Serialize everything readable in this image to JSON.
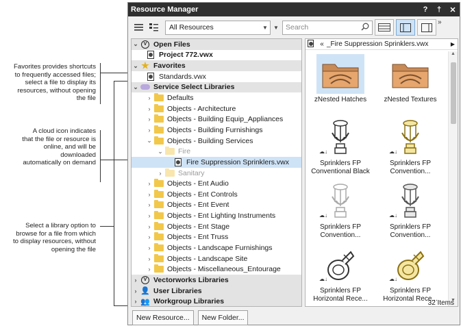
{
  "annotations": {
    "favorites": "Favorites provides shortcuts to frequently accessed files; select a file to display its resources, without opening the file",
    "cloud": "A cloud icon indicates that the file or resource is online, and will be downloaded automatically on demand",
    "libraries": "Select a library option to browse for a file from which to display resources, without opening the file"
  },
  "window": {
    "title": "Resource Manager",
    "help": "?",
    "pin": "†",
    "close": "✕"
  },
  "toolbar": {
    "filter_value": "All Resources",
    "search_placeholder": "Search",
    "more": "»"
  },
  "tree": {
    "open_files": "Open Files",
    "project": "Project 772.vwx",
    "favorites": "Favorites",
    "standards": "Standards.vwx",
    "service_select": "Service Select Libraries",
    "folders_a": [
      "Defaults",
      "Objects - Architecture",
      "Objects - Building Equip_Appliances",
      "Objects - Building Furnishings",
      "Objects - Building Services"
    ],
    "fire": "Fire",
    "fire_file": "Fire Suppression Sprinklers.vwx",
    "sanitary": "Sanitary",
    "folders_b": [
      "Objects - Ent Audio",
      "Objects - Ent Controls",
      "Objects - Ent Event",
      "Objects - Ent Lighting Instruments",
      "Objects - Ent Stage",
      "Objects - Ent Truss",
      "Objects - Landscape Furnishings",
      "Objects - Landscape Site",
      "Objects - Miscellaneous_Entourage"
    ],
    "vw_libraries": "Vectorworks Libraries",
    "user_libraries": "User Libraries",
    "workgroup_libraries": "Workgroup Libraries"
  },
  "grid": {
    "breadcrumb": "_Fire Suppression Sprinklers.vwx",
    "items": [
      {
        "label1": "zNested Hatches",
        "label2": "",
        "kind": "folder",
        "selected": true
      },
      {
        "label1": "zNested Textures",
        "label2": "",
        "kind": "folder",
        "selected": false
      },
      {
        "label1": "Sprinklers FP",
        "label2": "Conventional Black",
        "kind": "sprinkler-black"
      },
      {
        "label1": "Sprinklers FP",
        "label2": "Convention...",
        "kind": "sprinkler-gold"
      },
      {
        "label1": "Sprinklers FP",
        "label2": "Convention...",
        "kind": "sprinkler-white"
      },
      {
        "label1": "Sprinklers FP",
        "label2": "Convention...",
        "kind": "sprinkler-chrome"
      },
      {
        "label1": "Sprinklers FP",
        "label2": "Horizontal Rece...",
        "kind": "sprinkler-black-h"
      },
      {
        "label1": "Sprinklers FP",
        "label2": "Horizontal Rece...",
        "kind": "sprinkler-gold-h"
      }
    ],
    "count": "32 Items"
  },
  "buttons": {
    "new_resource": "New Resource...",
    "new_folder": "New Folder..."
  }
}
